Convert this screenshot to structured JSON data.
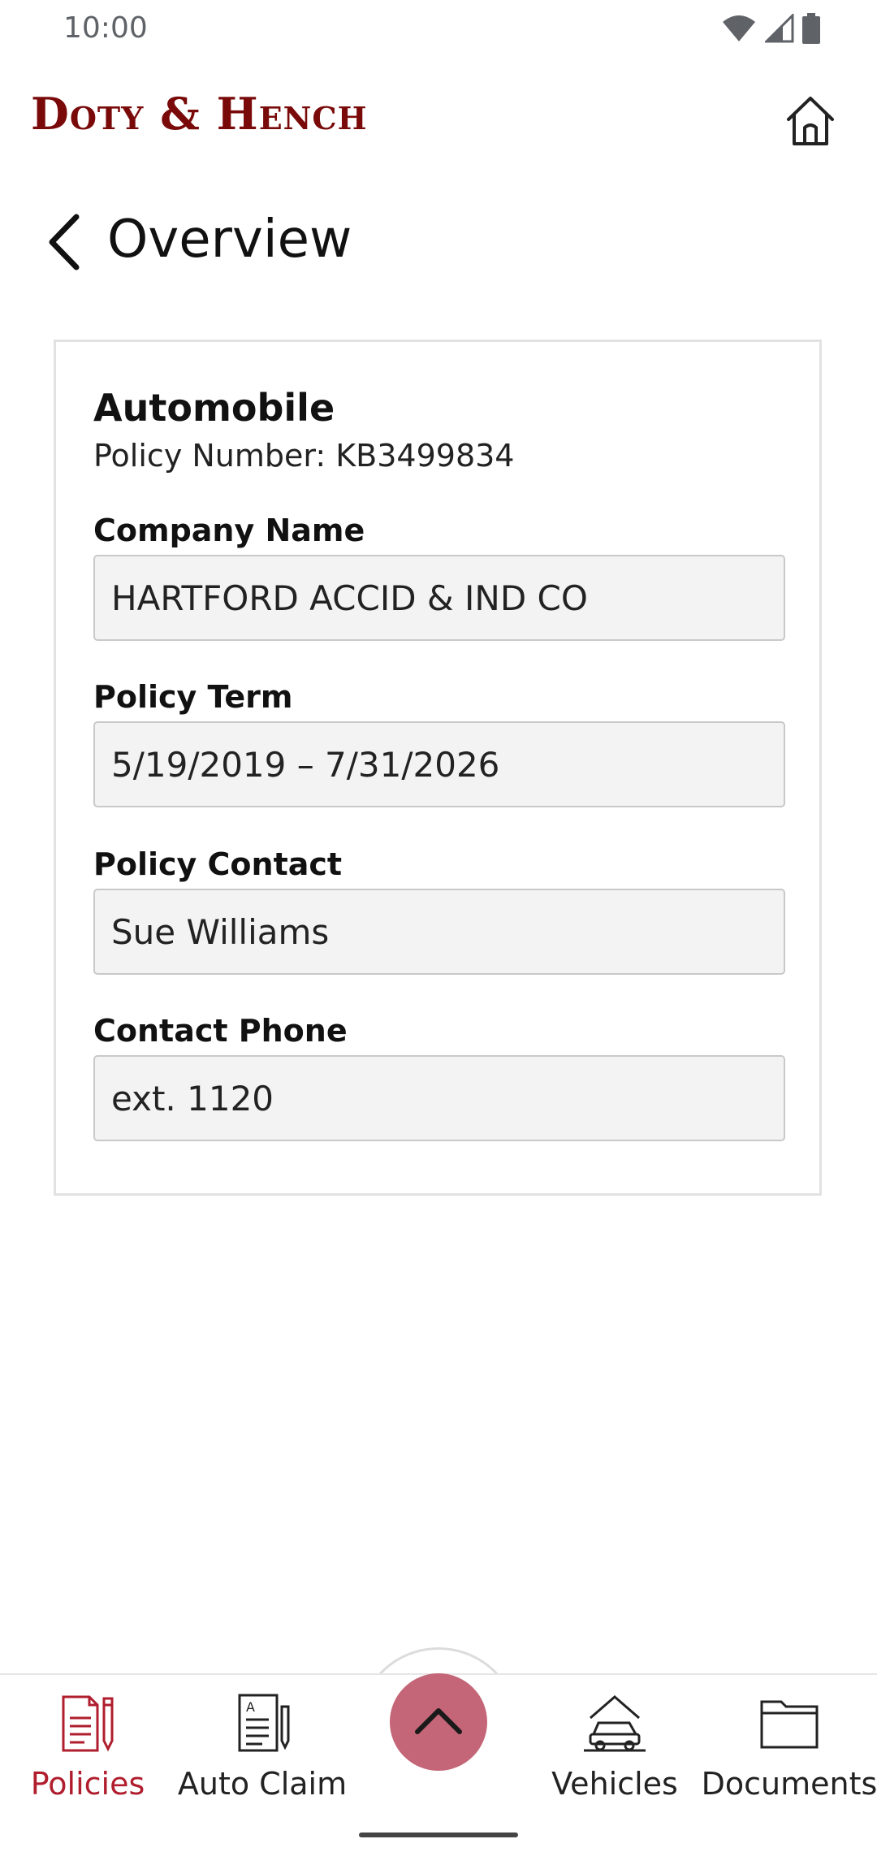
{
  "status_bar": {
    "time": "10:00",
    "icons": [
      "wifi-icon",
      "signal-icon",
      "battery-icon"
    ]
  },
  "header": {
    "brand": "Doty & Hench",
    "home_icon": "home-icon"
  },
  "page": {
    "title": "Overview",
    "back_icon": "chevron-left-icon"
  },
  "policy": {
    "type": "Automobile",
    "number_text": "Policy Number: KB3499834",
    "fields": [
      {
        "label": "Company Name",
        "value": "HARTFORD ACCID & IND CO"
      },
      {
        "label": "Policy Term",
        "value": "5/19/2019 – 7/31/2026"
      },
      {
        "label": "Policy Contact",
        "value": "Sue Williams"
      },
      {
        "label": "Contact Phone",
        "value": "ext. 1120"
      }
    ]
  },
  "bottom_nav": {
    "items": [
      {
        "label": "Policies",
        "icon": "policies-document-pencil-icon",
        "active": true
      },
      {
        "label": "Auto Claim",
        "icon": "auto-claim-form-icon",
        "active": false
      },
      {
        "label": "Vehicles",
        "icon": "vehicles-car-garage-icon",
        "active": false
      },
      {
        "label": "Documents",
        "icon": "documents-folder-icon",
        "active": false
      }
    ],
    "fab_icon": "chevron-up-icon"
  },
  "colors": {
    "brand": "#7a0a0a",
    "active_nav": "#b01e2e",
    "fab": "#c46677",
    "field_background": "#f3f3f4",
    "field_border": "#c9c9cc",
    "card_border": "#e2e2e2"
  }
}
